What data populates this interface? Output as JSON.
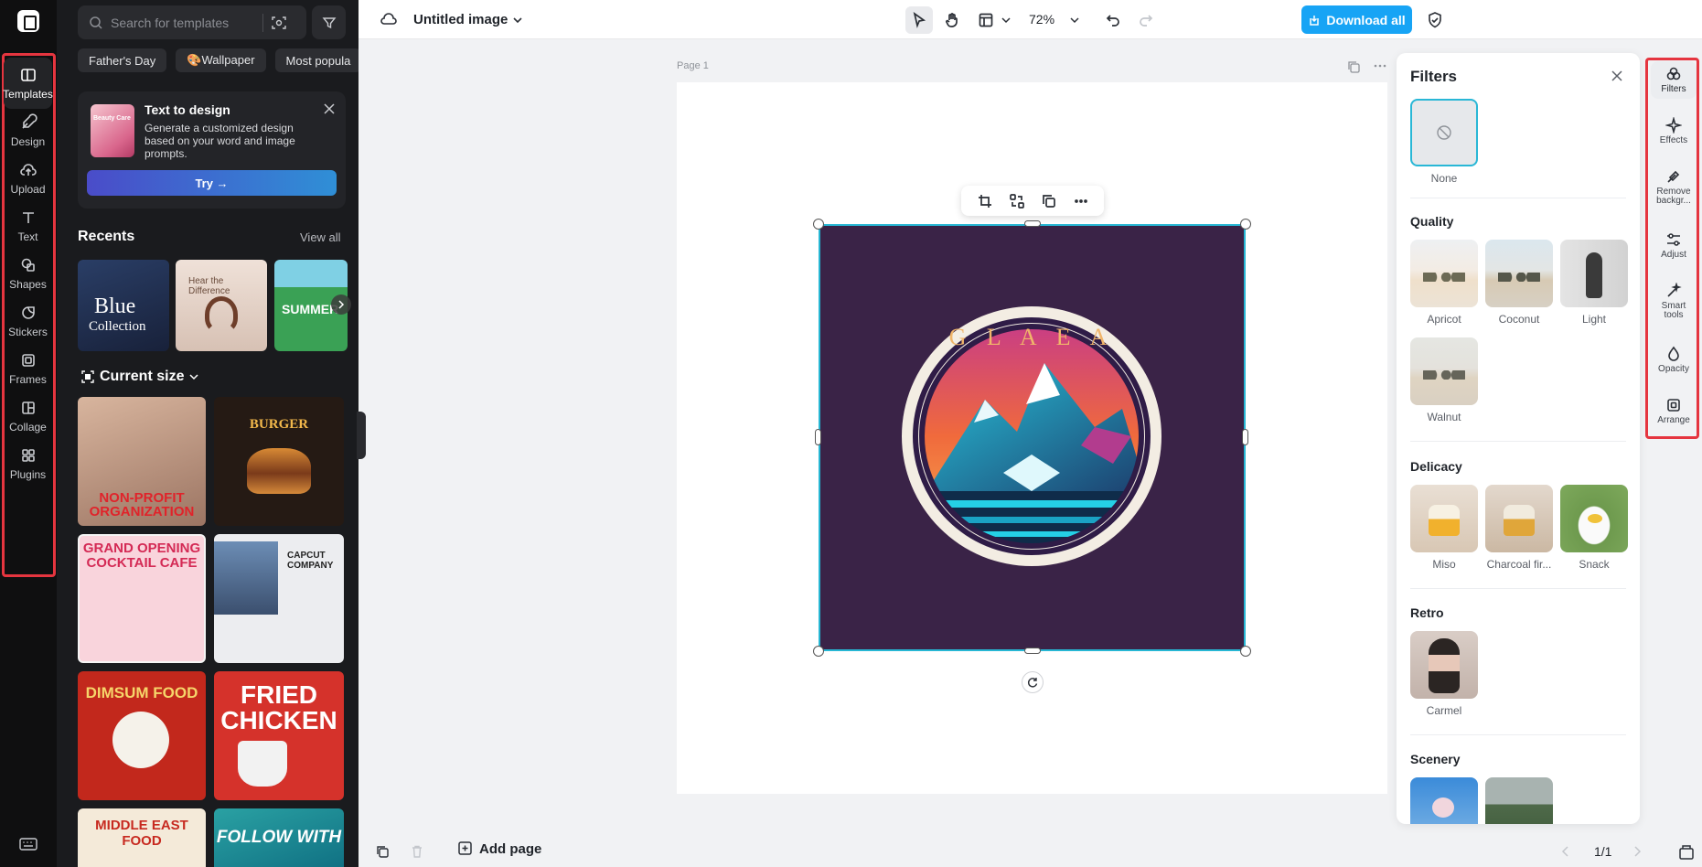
{
  "rail": {
    "items": [
      {
        "label": "Templates",
        "icon": "templates-icon",
        "active": true
      },
      {
        "label": "Design",
        "icon": "design-icon"
      },
      {
        "label": "Upload",
        "icon": "upload-icon"
      },
      {
        "label": "Text",
        "icon": "text-icon"
      },
      {
        "label": "Shapes",
        "icon": "shapes-icon"
      },
      {
        "label": "Stickers",
        "icon": "stickers-icon"
      },
      {
        "label": "Frames",
        "icon": "frames-icon"
      },
      {
        "label": "Collage",
        "icon": "collage-icon"
      },
      {
        "label": "Plugins",
        "icon": "plugins-icon"
      }
    ]
  },
  "search": {
    "placeholder": "Search for templates"
  },
  "chips": [
    "Father's Day",
    "🎨Wallpaper",
    "Most popula"
  ],
  "promo": {
    "title": "Text to design",
    "description": "Generate a customized design based on your word and image prompts.",
    "thumb_text": "Beauty Care",
    "button": "Try →"
  },
  "recents": {
    "heading": "Recents",
    "view_all": "View all",
    "items": [
      {
        "title": "Blue",
        "subtitle": "Collection"
      },
      {
        "title": "Hear the Difference"
      },
      {
        "title": "SUMMER"
      }
    ]
  },
  "current_size": {
    "heading": "Current size"
  },
  "templates": [
    {
      "title": "NON-PROFIT ORGANIZATION"
    },
    {
      "title": "BURGER"
    },
    {
      "title": "GRAND OPENING COCKTAIL CAFE"
    },
    {
      "title": "CAPCUT COMPANY"
    },
    {
      "title": "DIMSUM FOOD"
    },
    {
      "title": "FRIED CHICKEN"
    },
    {
      "title": "MIDDLE EAST FOOD"
    },
    {
      "title": "FOLLOW WITH"
    }
  ],
  "topbar": {
    "doc_title": "Untitled image",
    "zoom": "72%",
    "download": "Download all"
  },
  "canvas": {
    "page_label": "Page 1",
    "logo_text": "G L A E A"
  },
  "bottombar": {
    "add_page": "Add page",
    "pager": "1/1"
  },
  "filters": {
    "title": "Filters",
    "none_label": "None",
    "sections": [
      {
        "name": "Quality",
        "items": [
          "Apricot",
          "Coconut",
          "Light",
          "Walnut"
        ]
      },
      {
        "name": "Delicacy",
        "items": [
          "Miso",
          "Charcoal fir...",
          "Snack"
        ]
      },
      {
        "name": "Retro",
        "items": [
          "Carmel"
        ]
      },
      {
        "name": "Scenery",
        "items": []
      }
    ]
  },
  "right_rail": {
    "items": [
      {
        "label": "Filters",
        "icon": "filters-icon",
        "active": true
      },
      {
        "label": "Effects",
        "icon": "effects-icon"
      },
      {
        "label": "Remove backgr...",
        "icon": "remove-background-icon"
      },
      {
        "label": "Adjust",
        "icon": "adjust-icon"
      },
      {
        "label": "Smart tools",
        "icon": "smart-tools-icon"
      },
      {
        "label": "Opacity",
        "icon": "opacity-icon"
      },
      {
        "label": "Arrange",
        "icon": "arrange-icon"
      }
    ]
  }
}
